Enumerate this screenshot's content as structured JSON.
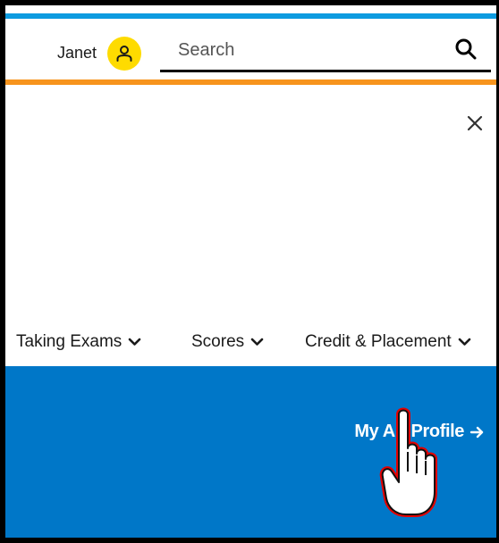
{
  "header": {
    "user_name": "Janet",
    "avatar_icon": "user-icon",
    "avatar_color": "#fedb00",
    "search": {
      "placeholder": "Search",
      "value": "",
      "icon": "search-icon"
    },
    "top_strip_color": "#0d9be0",
    "accent_strip_color": "#f7941d"
  },
  "menu": {
    "close_icon": "close-icon"
  },
  "nav": {
    "items": [
      {
        "label": "Taking Exams",
        "icon": "chevron-down-icon"
      },
      {
        "label": "Scores",
        "icon": "chevron-down-icon"
      },
      {
        "label": "Credit & Placement",
        "icon": "chevron-down-icon"
      }
    ]
  },
  "panel": {
    "background": "#0077c8",
    "profile_link": {
      "label": "My AP Profile",
      "icon": "arrow-right-icon"
    }
  },
  "cursor": {
    "icon": "hand-pointer-icon"
  }
}
